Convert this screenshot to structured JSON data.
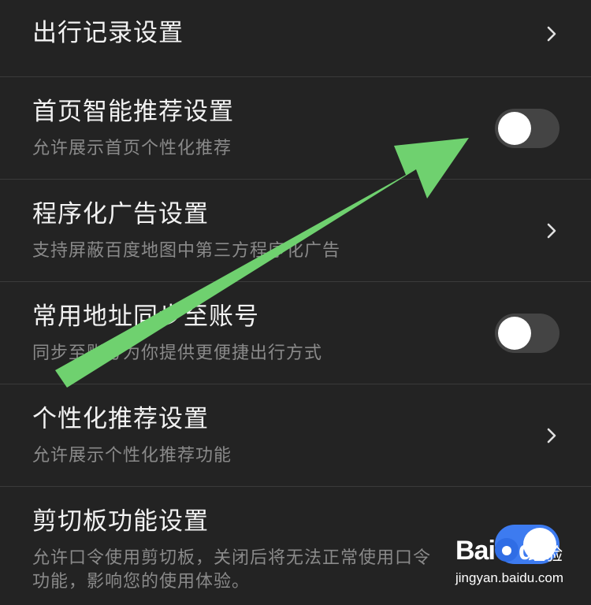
{
  "settings": {
    "rows": [
      {
        "title": "出行记录设置",
        "subtitle": "",
        "control": "chevron"
      },
      {
        "title": "首页智能推荐设置",
        "subtitle": "允许展示首页个性化推荐",
        "control": "toggle",
        "toggle_on": false
      },
      {
        "title": "程序化广告设置",
        "subtitle": "支持屏蔽百度地图中第三方程序化广告",
        "control": "chevron"
      },
      {
        "title": "常用地址同步至账号",
        "subtitle": "同步至账号为你提供更便捷出行方式",
        "control": "toggle",
        "toggle_on": false
      },
      {
        "title": "个性化推荐设置",
        "subtitle": "允许展示个性化推荐功能",
        "control": "chevron"
      },
      {
        "title": "剪切板功能设置",
        "subtitle": "允许口令使用剪切板，关闭后将无法正常使用口令",
        "subtitle_line2": "功能，影响您的使用体验。",
        "control": "toggle",
        "toggle_on": true
      }
    ]
  },
  "overlay": {
    "arrow_color": "#6fd16f",
    "arrow_icon": "arrow-pointer-icon"
  },
  "watermark": {
    "logo_text_1": "Bai",
    "logo_text_2": "du",
    "logo_sub": "经验",
    "url": "jingyan.baidu.com"
  },
  "colors": {
    "background": "#232323",
    "toggle_off": "#444444",
    "toggle_on": "#3d7bf0"
  }
}
